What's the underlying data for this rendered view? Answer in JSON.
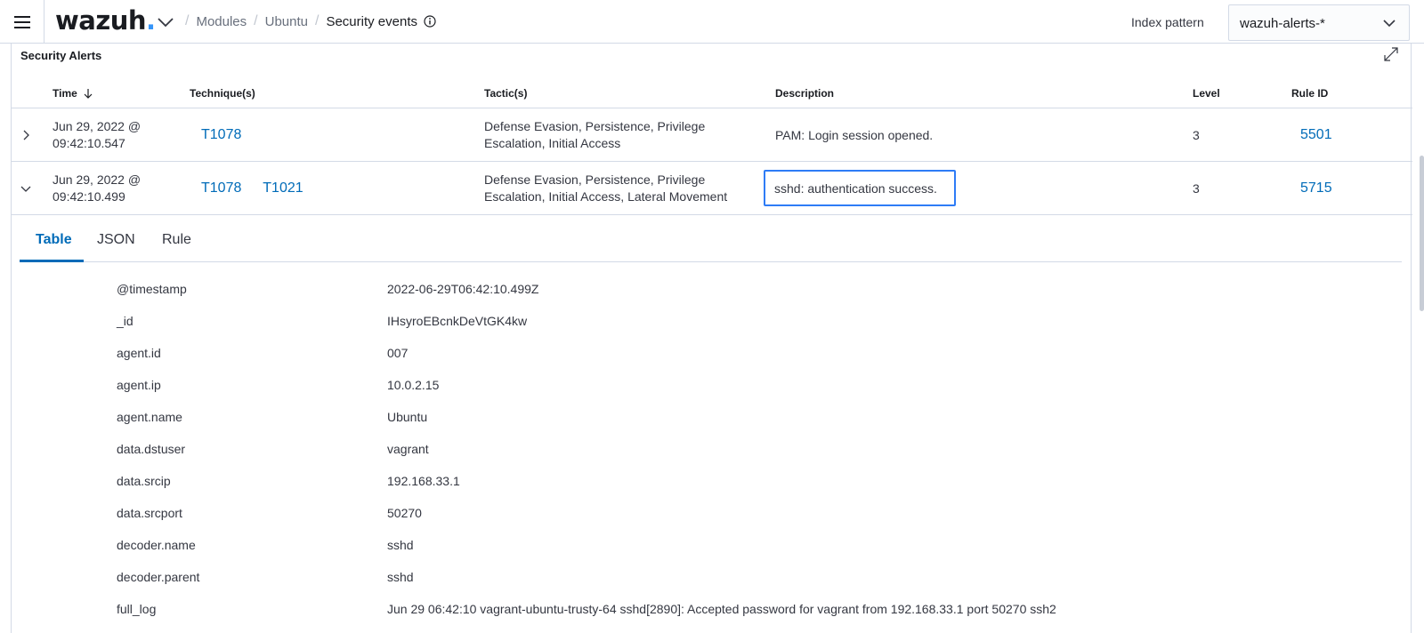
{
  "header": {
    "logo_text": "wazuh",
    "logo_dot": ".",
    "breadcrumbs": [
      "Modules",
      "Ubuntu"
    ],
    "current_page": "Security events",
    "index_pattern_label": "Index pattern",
    "index_pattern_value": "wazuh-alerts-*"
  },
  "panel": {
    "title": "Security Alerts",
    "columns": {
      "time": "Time",
      "techniques": "Technique(s)",
      "tactics": "Tactic(s)",
      "description": "Description",
      "level": "Level",
      "rule_id": "Rule ID"
    },
    "rows": [
      {
        "time_line1": "Jun 29, 2022 @",
        "time_line2": "09:42:10.547",
        "techniques": [
          "T1078"
        ],
        "tactics_line1": "Defense Evasion, Persistence, Privilege",
        "tactics_line2": "Escalation, Initial Access",
        "description": "PAM: Login session opened.",
        "level": "3",
        "rule_id": "5501"
      },
      {
        "time_line1": "Jun 29, 2022 @",
        "time_line2": "09:42:10.499",
        "techniques": [
          "T1078",
          "T1021"
        ],
        "tactics_line1": "Defense Evasion, Persistence, Privilege",
        "tactics_line2": "Escalation, Initial Access, Lateral Movement",
        "description": "sshd: authentication success.",
        "level": "3",
        "rule_id": "5715"
      }
    ]
  },
  "tabs": [
    "Table",
    "JSON",
    "Rule"
  ],
  "details": [
    {
      "key": "@timestamp",
      "value": "2022-06-29T06:42:10.499Z"
    },
    {
      "key": "_id",
      "value": "IHsyroEBcnkDeVtGK4kw"
    },
    {
      "key": "agent.id",
      "value": "007"
    },
    {
      "key": "agent.ip",
      "value": "10.0.2.15"
    },
    {
      "key": "agent.name",
      "value": "Ubuntu"
    },
    {
      "key": "data.dstuser",
      "value": "vagrant"
    },
    {
      "key": "data.srcip",
      "value": "192.168.33.1"
    },
    {
      "key": "data.srcport",
      "value": "50270"
    },
    {
      "key": "decoder.name",
      "value": "sshd"
    },
    {
      "key": "decoder.parent",
      "value": "sshd"
    },
    {
      "key": "full_log",
      "value": "Jun 29 06:42:10 vagrant-ubuntu-trusty-64 sshd[2890]: Accepted password for vagrant from 192.168.33.1 port 50270 ssh2"
    }
  ],
  "colors": {
    "accent": "#006bb8",
    "focus": "#2e7cf6",
    "border": "#d3dae6"
  }
}
